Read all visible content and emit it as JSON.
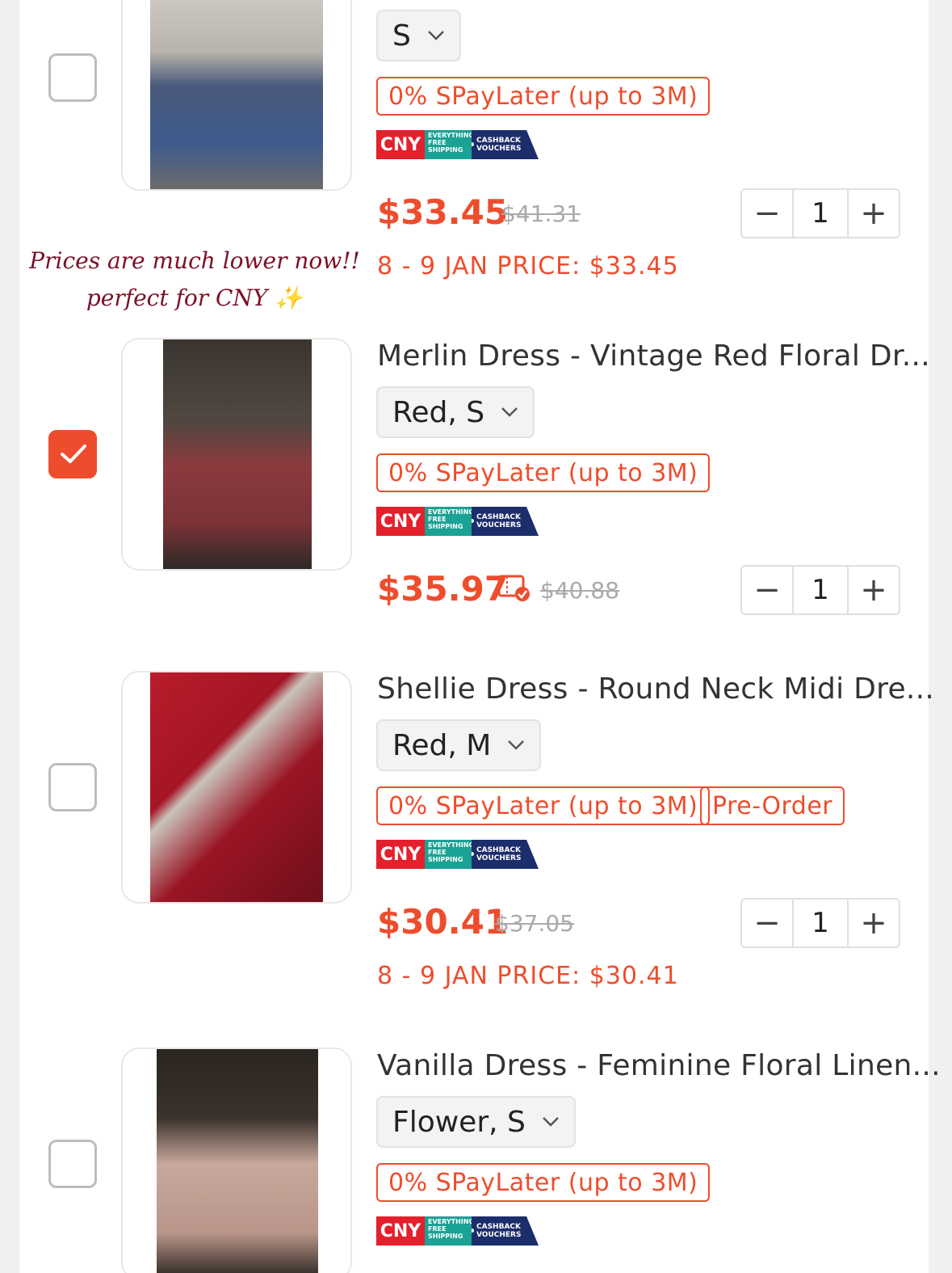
{
  "note": {
    "line1": "Prices are much lower now!!",
    "line2": "perfect for CNY ✨"
  },
  "items": [
    {
      "title": "",
      "variant": "S",
      "tags": [
        "0% SPayLater (up to 3M)"
      ],
      "badge": {
        "cny": "CNY",
        "shipping": "EVERYTHING FREE SHIPPING",
        "cashback": "CASHBACK VOUCHERS"
      },
      "price": "$33.45",
      "original_price": "$41.31",
      "quantity": "1",
      "promo": "8 - 9 JAN PRICE: $33.45",
      "checked": false,
      "photo_color": "#3e5b8c"
    },
    {
      "title": "Merlin Dress - Vintage Red Floral Dr...",
      "variant": "Red, S",
      "tags": [
        "0% SPayLater (up to 3M)"
      ],
      "badge": {
        "cny": "CNY",
        "shipping": "EVERYTHING FREE SHIPPING",
        "cashback": "CASHBACK VOUCHERS"
      },
      "price": "$35.97",
      "original_price": "$40.88",
      "quantity": "1",
      "promo": "",
      "checked": true,
      "photo_color": "#8c3a3e"
    },
    {
      "title": "Shellie Dress - Round Neck Midi Dre...",
      "variant": "Red, M",
      "tags": [
        "0% SPayLater (up to 3M)",
        "Pre-Order"
      ],
      "badge": {
        "cny": "CNY",
        "shipping": "EVERYTHING FREE SHIPPING",
        "cashback": "CASHBACK VOUCHERS"
      },
      "price": "$30.41",
      "original_price": "$37.05",
      "quantity": "1",
      "promo": "8 - 9 JAN PRICE: $30.41",
      "checked": false,
      "photo_color": "#9a1525"
    },
    {
      "title": "Vanilla Dress - Feminine Floral Linen...",
      "variant": "Flower, S",
      "tags": [
        "0% SPayLater (up to 3M)"
      ],
      "badge": {
        "cny": "CNY",
        "shipping": "EVERYTHING FREE SHIPPING",
        "cashback": "CASHBACK VOUCHERS"
      },
      "price": "",
      "original_price": "",
      "quantity": "",
      "promo": "",
      "checked": false,
      "photo_color": "#2b2520"
    }
  ],
  "colors": {
    "accent": "#ee4d2d",
    "note": "#7a1026"
  },
  "icons": {
    "checkmark": "checkmark-icon",
    "chevron": "chevron-down-icon",
    "voucher": "voucher-applied-icon",
    "minus": "minus-icon",
    "plus": "plus-icon"
  },
  "stepper": {
    "minus": "−",
    "plus": "+"
  }
}
